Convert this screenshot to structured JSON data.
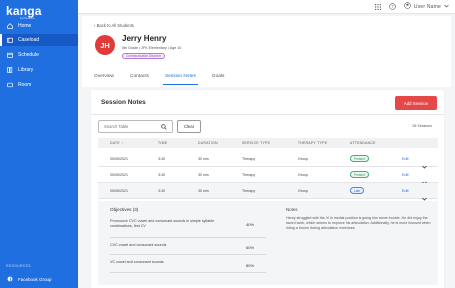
{
  "brand": {
    "name": "kanga",
    "sub": "by Presence",
    "accent": "#1f6fe0",
    "danger": "#e44848"
  },
  "sidebar": {
    "items": [
      {
        "label": "Home",
        "icon": "home-icon"
      },
      {
        "label": "Caseload",
        "icon": "caseload-icon",
        "active": true
      },
      {
        "label": "Schedule",
        "icon": "calendar-icon"
      },
      {
        "label": "Library",
        "icon": "library-icon"
      },
      {
        "label": "Room",
        "icon": "room-icon"
      }
    ],
    "resources_title": "RESOURCES",
    "facebook_label": "Facebook Group"
  },
  "topbar": {
    "user_name": "User Name"
  },
  "student": {
    "back_label": "Back to All Students",
    "initials": "JH",
    "name": "Jerry Henry",
    "meta": "5th Grade • JFK Elementary • Age 10",
    "plan_badge": "Communication Disorder"
  },
  "tabs": [
    "Overview",
    "Contacts",
    "Session Notes",
    "Goals"
  ],
  "notes": {
    "title": "Session Notes",
    "add_label": "Add Session",
    "search_placeholder": "Search Table",
    "clear_label": "Clear",
    "count": "26 Sessions",
    "columns": [
      "DATE ↑",
      "TIME",
      "DURATION",
      "SERVICE TYPE",
      "THERAPY TYPE",
      "ATTENDANCE"
    ],
    "rows": [
      {
        "date": "05/05/2021",
        "time": "3:30",
        "duration": "30 min",
        "service": "Therapy",
        "therapy": "Group",
        "attendance": "Present",
        "att_type": "present",
        "edit": "Edit"
      },
      {
        "date": "05/05/2021",
        "time": "3:30",
        "duration": "30 min",
        "service": "Therapy",
        "therapy": "Group",
        "attendance": "Present",
        "att_type": "present",
        "edit": "Edit"
      },
      {
        "date": "05/05/2021",
        "time": "3:30",
        "duration": "30 min",
        "service": "Therapy",
        "therapy": "Group",
        "attendance": "Late",
        "att_type": "late",
        "edit": "Edit"
      }
    ],
    "detail": {
      "objectives_title": "Objectives (3)",
      "objectives": [
        {
          "text": "Pronounce CVC vowel and consonant sounds in simple syllable combinations, first CV",
          "pct": "40%"
        },
        {
          "text": "CVC vowel and consonant sounds",
          "pct": "60%"
        },
        {
          "text": "VC vowel and consonant sounds",
          "pct": "80%"
        }
      ],
      "notes_label": "Notes",
      "notes_text": "Henry struggled with the /r/ in medial position is going him some trouble. He did enjoy the sword work, which seems to improve his articulation. Additionally, he is more focused when riding a broom during articulation exercises."
    }
  }
}
